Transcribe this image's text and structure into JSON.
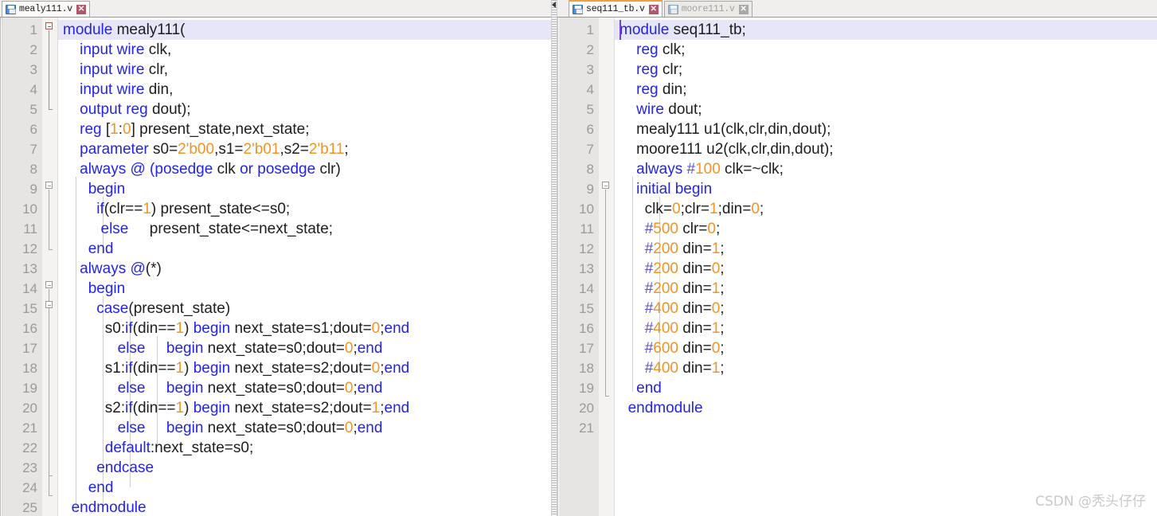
{
  "left_panel": {
    "tab": {
      "label": "mealy111.v",
      "icon": "floppy-disk-icon",
      "close_icon": "close-icon",
      "active": true
    },
    "line_count": 25,
    "line_numbers": [
      "1",
      "2",
      "3",
      "4",
      "5",
      "6",
      "7",
      "8",
      "9",
      "10",
      "11",
      "12",
      "13",
      "14",
      "15",
      "16",
      "17",
      "18",
      "19",
      "20",
      "21",
      "22",
      "23",
      "24",
      "25"
    ],
    "lines": [
      [
        {
          "t": "module ",
          "c": "kw"
        },
        {
          "t": "mealy111(",
          "c": "id"
        }
      ],
      [
        {
          "t": "    ",
          "c": "id"
        },
        {
          "t": "input wire ",
          "c": "kw"
        },
        {
          "t": "clk,",
          "c": "id"
        }
      ],
      [
        {
          "t": "    ",
          "c": "id"
        },
        {
          "t": "input wire ",
          "c": "kw"
        },
        {
          "t": "clr,",
          "c": "id"
        }
      ],
      [
        {
          "t": "    ",
          "c": "id"
        },
        {
          "t": "input wire ",
          "c": "kw"
        },
        {
          "t": "din,",
          "c": "id"
        }
      ],
      [
        {
          "t": "    ",
          "c": "id"
        },
        {
          "t": "output reg ",
          "c": "kw"
        },
        {
          "t": "dout);",
          "c": "id"
        }
      ],
      [
        {
          "t": "    ",
          "c": "id"
        },
        {
          "t": "reg ",
          "c": "kw"
        },
        {
          "t": "[",
          "c": "id"
        },
        {
          "t": "1",
          "c": "num"
        },
        {
          "t": ":",
          "c": "id"
        },
        {
          "t": "0",
          "c": "num"
        },
        {
          "t": "] present_state,next_state;",
          "c": "id"
        }
      ],
      [
        {
          "t": "    ",
          "c": "id"
        },
        {
          "t": "parameter ",
          "c": "kw"
        },
        {
          "t": "s0=",
          "c": "id"
        },
        {
          "t": "2'b00",
          "c": "num"
        },
        {
          "t": ",s1=",
          "c": "id"
        },
        {
          "t": "2'b01",
          "c": "num"
        },
        {
          "t": ",s2=",
          "c": "id"
        },
        {
          "t": "2'b11",
          "c": "num"
        },
        {
          "t": ";",
          "c": "id"
        }
      ],
      [
        {
          "t": "    ",
          "c": "id"
        },
        {
          "t": "always @ (",
          "c": "kw"
        },
        {
          "t": "posedge ",
          "c": "kw"
        },
        {
          "t": "clk ",
          "c": "id"
        },
        {
          "t": "or ",
          "c": "kw"
        },
        {
          "t": "posedge ",
          "c": "kw"
        },
        {
          "t": "clr)",
          "c": "id"
        }
      ],
      [
        {
          "t": "      ",
          "c": "id"
        },
        {
          "t": "begin",
          "c": "kw"
        }
      ],
      [
        {
          "t": "        ",
          "c": "id"
        },
        {
          "t": "if",
          "c": "kw"
        },
        {
          "t": "(clr==",
          "c": "id"
        },
        {
          "t": "1",
          "c": "num"
        },
        {
          "t": ") present_state<=s0;",
          "c": "id"
        }
      ],
      [
        {
          "t": "         ",
          "c": "id"
        },
        {
          "t": "else",
          "c": "kw"
        },
        {
          "t": "     present_state<=next_state;",
          "c": "id"
        }
      ],
      [
        {
          "t": "      ",
          "c": "id"
        },
        {
          "t": "end",
          "c": "kw"
        }
      ],
      [
        {
          "t": "    ",
          "c": "id"
        },
        {
          "t": "always @",
          "c": "kw"
        },
        {
          "t": "(*)",
          "c": "id"
        }
      ],
      [
        {
          "t": "      ",
          "c": "id"
        },
        {
          "t": "begin",
          "c": "kw"
        }
      ],
      [
        {
          "t": "        ",
          "c": "id"
        },
        {
          "t": "case",
          "c": "kw"
        },
        {
          "t": "(present_state)",
          "c": "id"
        }
      ],
      [
        {
          "t": "          s0:",
          "c": "id"
        },
        {
          "t": "if",
          "c": "kw"
        },
        {
          "t": "(din==",
          "c": "id"
        },
        {
          "t": "1",
          "c": "num"
        },
        {
          "t": ") ",
          "c": "id"
        },
        {
          "t": "begin",
          "c": "kw"
        },
        {
          "t": " next_state=s1;dout=",
          "c": "id"
        },
        {
          "t": "0",
          "c": "num"
        },
        {
          "t": ";",
          "c": "id"
        },
        {
          "t": "end",
          "c": "kw"
        }
      ],
      [
        {
          "t": "             ",
          "c": "id"
        },
        {
          "t": "else",
          "c": "kw"
        },
        {
          "t": "     ",
          "c": "id"
        },
        {
          "t": "begin",
          "c": "kw"
        },
        {
          "t": " next_state=s0;dout=",
          "c": "id"
        },
        {
          "t": "0",
          "c": "num"
        },
        {
          "t": ";",
          "c": "id"
        },
        {
          "t": "end",
          "c": "kw"
        }
      ],
      [
        {
          "t": "          s1:",
          "c": "id"
        },
        {
          "t": "if",
          "c": "kw"
        },
        {
          "t": "(din==",
          "c": "id"
        },
        {
          "t": "1",
          "c": "num"
        },
        {
          "t": ") ",
          "c": "id"
        },
        {
          "t": "begin",
          "c": "kw"
        },
        {
          "t": " next_state=s2;dout=",
          "c": "id"
        },
        {
          "t": "0",
          "c": "num"
        },
        {
          "t": ";",
          "c": "id"
        },
        {
          "t": "end",
          "c": "kw"
        }
      ],
      [
        {
          "t": "             ",
          "c": "id"
        },
        {
          "t": "else",
          "c": "kw"
        },
        {
          "t": "     ",
          "c": "id"
        },
        {
          "t": "begin",
          "c": "kw"
        },
        {
          "t": " next_state=s0;dout=",
          "c": "id"
        },
        {
          "t": "0",
          "c": "num"
        },
        {
          "t": ";",
          "c": "id"
        },
        {
          "t": "end",
          "c": "kw"
        }
      ],
      [
        {
          "t": "          s2:",
          "c": "id"
        },
        {
          "t": "if",
          "c": "kw"
        },
        {
          "t": "(din==",
          "c": "id"
        },
        {
          "t": "1",
          "c": "num"
        },
        {
          "t": ") ",
          "c": "id"
        },
        {
          "t": "begin",
          "c": "kw"
        },
        {
          "t": " next_state=s2;dout=",
          "c": "id"
        },
        {
          "t": "1",
          "c": "num"
        },
        {
          "t": ";",
          "c": "id"
        },
        {
          "t": "end",
          "c": "kw"
        }
      ],
      [
        {
          "t": "             ",
          "c": "id"
        },
        {
          "t": "else",
          "c": "kw"
        },
        {
          "t": "     ",
          "c": "id"
        },
        {
          "t": "begin",
          "c": "kw"
        },
        {
          "t": " next_state=s0;dout=",
          "c": "id"
        },
        {
          "t": "0",
          "c": "num"
        },
        {
          "t": ";",
          "c": "id"
        },
        {
          "t": "end",
          "c": "kw"
        }
      ],
      [
        {
          "t": "          ",
          "c": "id"
        },
        {
          "t": "default",
          "c": "kw"
        },
        {
          "t": ":next_state=s0;",
          "c": "id"
        }
      ],
      [
        {
          "t": "        ",
          "c": "id"
        },
        {
          "t": "endcase",
          "c": "kw"
        }
      ],
      [
        {
          "t": "      ",
          "c": "id"
        },
        {
          "t": "end",
          "c": "kw"
        }
      ],
      [
        {
          "t": "  ",
          "c": "id"
        },
        {
          "t": "endmodule",
          "c": "kw"
        }
      ]
    ]
  },
  "right_panel": {
    "tabs": [
      {
        "label": "seq111_tb.v",
        "icon": "floppy-disk-icon",
        "close_icon": "close-icon",
        "active": true
      },
      {
        "label": "moore111.v",
        "icon": "floppy-disk-icon",
        "close_icon": "close-icon",
        "active": false
      }
    ],
    "line_count": 21,
    "line_numbers": [
      "1",
      "2",
      "3",
      "4",
      "5",
      "6",
      "7",
      "8",
      "9",
      "10",
      "11",
      "12",
      "13",
      "14",
      "15",
      "16",
      "17",
      "18",
      "19",
      "20",
      "21"
    ],
    "lines": [
      [
        {
          "t": "module ",
          "c": "kw"
        },
        {
          "t": "seq111_tb;",
          "c": "id"
        }
      ],
      [
        {
          "t": "    ",
          "c": "id"
        },
        {
          "t": "reg ",
          "c": "kw"
        },
        {
          "t": "clk;",
          "c": "id"
        }
      ],
      [
        {
          "t": "    ",
          "c": "id"
        },
        {
          "t": "reg ",
          "c": "kw"
        },
        {
          "t": "clr;",
          "c": "id"
        }
      ],
      [
        {
          "t": "    ",
          "c": "id"
        },
        {
          "t": "reg ",
          "c": "kw"
        },
        {
          "t": "din;",
          "c": "id"
        }
      ],
      [
        {
          "t": "    ",
          "c": "id"
        },
        {
          "t": "wire ",
          "c": "kw"
        },
        {
          "t": "dout;",
          "c": "id"
        }
      ],
      [
        {
          "t": "    mealy111 u1(clk,clr,din,dout);",
          "c": "id"
        }
      ],
      [
        {
          "t": "    moore111 u2(clk,clr,din,dout);",
          "c": "id"
        }
      ],
      [
        {
          "t": "    ",
          "c": "id"
        },
        {
          "t": "always ",
          "c": "kw"
        },
        {
          "t": "#",
          "c": "pl"
        },
        {
          "t": "100",
          "c": "num"
        },
        {
          "t": " clk=~clk;",
          "c": "id"
        }
      ],
      [
        {
          "t": "    ",
          "c": "id"
        },
        {
          "t": "initial begin",
          "c": "kw"
        }
      ],
      [
        {
          "t": "      clk=",
          "c": "id"
        },
        {
          "t": "0",
          "c": "num"
        },
        {
          "t": ";clr=",
          "c": "id"
        },
        {
          "t": "1",
          "c": "num"
        },
        {
          "t": ";din=",
          "c": "id"
        },
        {
          "t": "0",
          "c": "num"
        },
        {
          "t": ";",
          "c": "id"
        }
      ],
      [
        {
          "t": "      ",
          "c": "id"
        },
        {
          "t": "#",
          "c": "pl"
        },
        {
          "t": "500",
          "c": "num"
        },
        {
          "t": " clr=",
          "c": "id"
        },
        {
          "t": "0",
          "c": "num"
        },
        {
          "t": ";",
          "c": "id"
        }
      ],
      [
        {
          "t": "      ",
          "c": "id"
        },
        {
          "t": "#",
          "c": "pl"
        },
        {
          "t": "200",
          "c": "num"
        },
        {
          "t": " din=",
          "c": "id"
        },
        {
          "t": "1",
          "c": "num"
        },
        {
          "t": ";",
          "c": "id"
        }
      ],
      [
        {
          "t": "      ",
          "c": "id"
        },
        {
          "t": "#",
          "c": "pl"
        },
        {
          "t": "200",
          "c": "num"
        },
        {
          "t": " din=",
          "c": "id"
        },
        {
          "t": "0",
          "c": "num"
        },
        {
          "t": ";",
          "c": "id"
        }
      ],
      [
        {
          "t": "      ",
          "c": "id"
        },
        {
          "t": "#",
          "c": "pl"
        },
        {
          "t": "200",
          "c": "num"
        },
        {
          "t": " din=",
          "c": "id"
        },
        {
          "t": "1",
          "c": "num"
        },
        {
          "t": ";",
          "c": "id"
        }
      ],
      [
        {
          "t": "      ",
          "c": "id"
        },
        {
          "t": "#",
          "c": "pl"
        },
        {
          "t": "400",
          "c": "num"
        },
        {
          "t": " din=",
          "c": "id"
        },
        {
          "t": "0",
          "c": "num"
        },
        {
          "t": ";",
          "c": "id"
        }
      ],
      [
        {
          "t": "      ",
          "c": "id"
        },
        {
          "t": "#",
          "c": "pl"
        },
        {
          "t": "400",
          "c": "num"
        },
        {
          "t": " din=",
          "c": "id"
        },
        {
          "t": "1",
          "c": "num"
        },
        {
          "t": ";",
          "c": "id"
        }
      ],
      [
        {
          "t": "      ",
          "c": "id"
        },
        {
          "t": "#",
          "c": "pl"
        },
        {
          "t": "600",
          "c": "num"
        },
        {
          "t": " din=",
          "c": "id"
        },
        {
          "t": "0",
          "c": "num"
        },
        {
          "t": ";",
          "c": "id"
        }
      ],
      [
        {
          "t": "      ",
          "c": "id"
        },
        {
          "t": "#",
          "c": "pl"
        },
        {
          "t": "400",
          "c": "num"
        },
        {
          "t": " din=",
          "c": "id"
        },
        {
          "t": "1",
          "c": "num"
        },
        {
          "t": ";",
          "c": "id"
        }
      ],
      [
        {
          "t": "    ",
          "c": "id"
        },
        {
          "t": "end",
          "c": "kw"
        }
      ],
      [
        {
          "t": "  ",
          "c": "id"
        },
        {
          "t": "endmodule",
          "c": "kw"
        }
      ],
      [
        {
          "t": "",
          "c": "id"
        }
      ]
    ]
  },
  "splitter": {
    "collapse_icon": "collapse-left-arrow-icon"
  },
  "watermark": {
    "text": "CSDN @秃头仔仔"
  },
  "colors": {
    "keyword": "#2424e8",
    "number": "#f29324",
    "identifier": "#1d1d1d",
    "current_line_bg": "#e7e6f8",
    "gutter_bg": "#e6e5e3",
    "tab_accent": "#f2a03c",
    "caret": "#7d3fbf"
  }
}
